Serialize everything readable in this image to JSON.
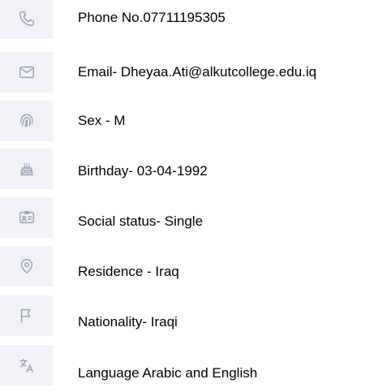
{
  "items": [
    {
      "icon": "phone-icon",
      "text": "Phone No.07711195305"
    },
    {
      "icon": "mail-icon",
      "text": "Email- Dheyaa.Ati@alkutcollege.edu.iq"
    },
    {
      "icon": "fingerprint-icon",
      "text": "Sex - M"
    },
    {
      "icon": "cake-icon",
      "text": "Birthday- 03-04-1992"
    },
    {
      "icon": "id-card-icon",
      "text": "Social status- Single"
    },
    {
      "icon": "location-pin-icon",
      "text": "Residence - Iraq"
    },
    {
      "icon": "flag-icon",
      "text": "Nationality- Iraqi"
    },
    {
      "icon": "translate-icon",
      "text": "Language Arabic and English"
    }
  ]
}
